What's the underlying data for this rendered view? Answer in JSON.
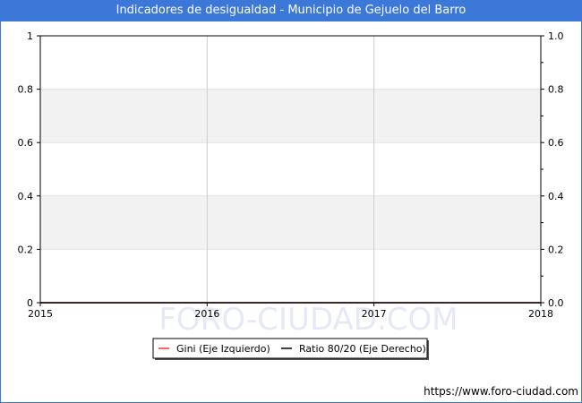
{
  "title": "Indicadores de desigualdad - Municipio de Gejuelo del Barro",
  "watermark": "FORO-CIUDAD.COM",
  "source": "https://www.foro-ciudad.com",
  "colors": {
    "title_bg": "#3c78d8",
    "gini": "#ff3333",
    "ratio": "#000000",
    "band": "#f2f2f2",
    "grid": "#cccccc"
  },
  "chart_data": {
    "type": "line",
    "x": [
      2015,
      2016,
      2017,
      2018
    ],
    "x_tick_labels": [
      "2015",
      "2016",
      "2017",
      "2018"
    ],
    "xlim": [
      2015,
      2018
    ],
    "y_left": {
      "ylim": [
        0,
        1
      ],
      "tick_labels": [
        "0",
        "0.2",
        "0.4",
        "0.6",
        "0.8",
        "1"
      ],
      "ticks": [
        0,
        0.2,
        0.4,
        0.6,
        0.8,
        1
      ]
    },
    "y_right": {
      "ylim": [
        0,
        1
      ],
      "tick_labels": [
        "0.0",
        "0.2",
        "0.4",
        "0.6",
        "0.8",
        "1.0"
      ],
      "ticks": [
        0,
        0.2,
        0.4,
        0.6,
        0.8,
        1
      ]
    },
    "series": [
      {
        "name": "Gini (Eje Izquierdo)",
        "axis": "left",
        "color": "#ff3333",
        "values": [
          0,
          0,
          0,
          0
        ]
      },
      {
        "name": "Ratio 80/20 (Eje Derecho)",
        "axis": "right",
        "color": "#000000",
        "values": [
          0,
          0,
          0,
          0
        ]
      }
    ],
    "grid": true,
    "legend": "bottom"
  }
}
